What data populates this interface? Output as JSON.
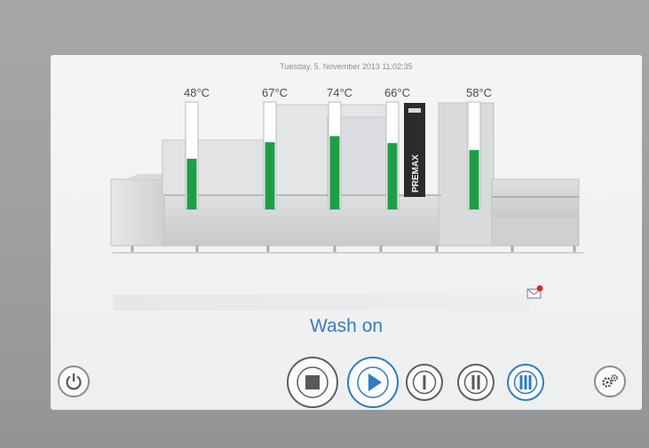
{
  "datetime": "Tuesday, 5. November 2013 11:02:35",
  "machine": {
    "brand": "PREMAX",
    "tanks": [
      {
        "label": "48°C",
        "level": 0.48
      },
      {
        "label": "67°C",
        "level": 0.67
      },
      {
        "label": "74°C",
        "level": 0.74
      },
      {
        "label": "66°C",
        "level": 0.66
      },
      {
        "label": "58°C",
        "level": 0.58
      }
    ],
    "fill_color": "#1e9e47"
  },
  "status": {
    "text": "Wash on",
    "color": "#3a7bbf"
  },
  "controls": {
    "power": "power-icon",
    "stop": "stop-icon",
    "play": "play-icon",
    "speed1": "speed-1-icon",
    "speed2": "speed-2-icon",
    "speed3": "speed-3-icon",
    "settings": "gears-icon",
    "active_color": "#2e7cc4"
  },
  "message_icon": "message-alert-icon"
}
